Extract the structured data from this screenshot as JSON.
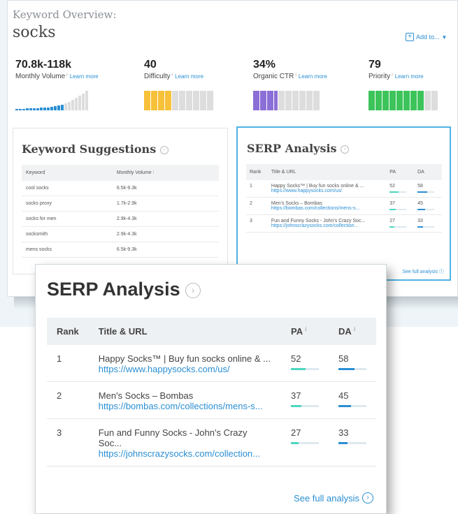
{
  "header": {
    "title": "Keyword Overview:",
    "keyword": "socks",
    "add_to": "Add to..."
  },
  "metrics": [
    {
      "value": "70.8k-118k",
      "label": "Monthly Volume",
      "learn": "Learn more"
    },
    {
      "value": "40",
      "label": "Difficulty",
      "learn": "Learn more"
    },
    {
      "value": "34%",
      "label": "Organic CTR",
      "learn": "Learn more"
    },
    {
      "value": "79",
      "label": "Priority",
      "learn": "Learn more"
    }
  ],
  "colors": {
    "accent": "#2a8fd3",
    "volume": "#2a8fd3",
    "difficulty": "#f8c13a",
    "ctr": "#8c6fd6",
    "priority": "#3cc45a",
    "pa": "#4dd6c0",
    "da": "#2a8fd3"
  },
  "suggestions": {
    "title": "Keyword Suggestions",
    "headers": [
      "Keyword",
      "Monthly Volume"
    ],
    "rows": [
      [
        "cool socks",
        "6.5k-9.3k"
      ],
      [
        "socks proxy",
        "1.7k-2.9k"
      ],
      [
        "socks for men",
        "2.9k-4.3k"
      ],
      [
        "socksmith",
        "2.9k-4.3k"
      ],
      [
        "mens socks",
        "6.5k-9.3k"
      ]
    ]
  },
  "serp": {
    "title": "SERP Analysis",
    "headers": [
      "Rank",
      "Title & URL",
      "PA",
      "DA"
    ],
    "rows": [
      {
        "rank": "1",
        "title": "Happy Socks™ | Buy fun socks online & ...",
        "url": "https://www.happysocks.com/us/",
        "pa": "52",
        "da": "58"
      },
      {
        "rank": "2",
        "title": "Men's Socks – Bombas",
        "url": "https://bombas.com/collections/mens-s...",
        "pa": "37",
        "da": "45"
      },
      {
        "rank": "3",
        "title": "Fun and Funny Socks - John's Crazy Soc...",
        "url": "https://johnscrazysocks.com/collection...",
        "pa": "27",
        "da": "33"
      }
    ],
    "small_rows": [
      {
        "title": "Happy Socks™ | Buy fun socks online & ...",
        "url": "https://www.happysocks.com/us/"
      },
      {
        "title": "Men's Socks – Bombas",
        "url": "https://bombas.com/collections/mens-s..."
      },
      {
        "title": "Fun and Funny Socks - John's Crazy Soc...",
        "url": "https://johnscrazysocks.com/collection..."
      }
    ],
    "see_full": "See full analysis"
  }
}
